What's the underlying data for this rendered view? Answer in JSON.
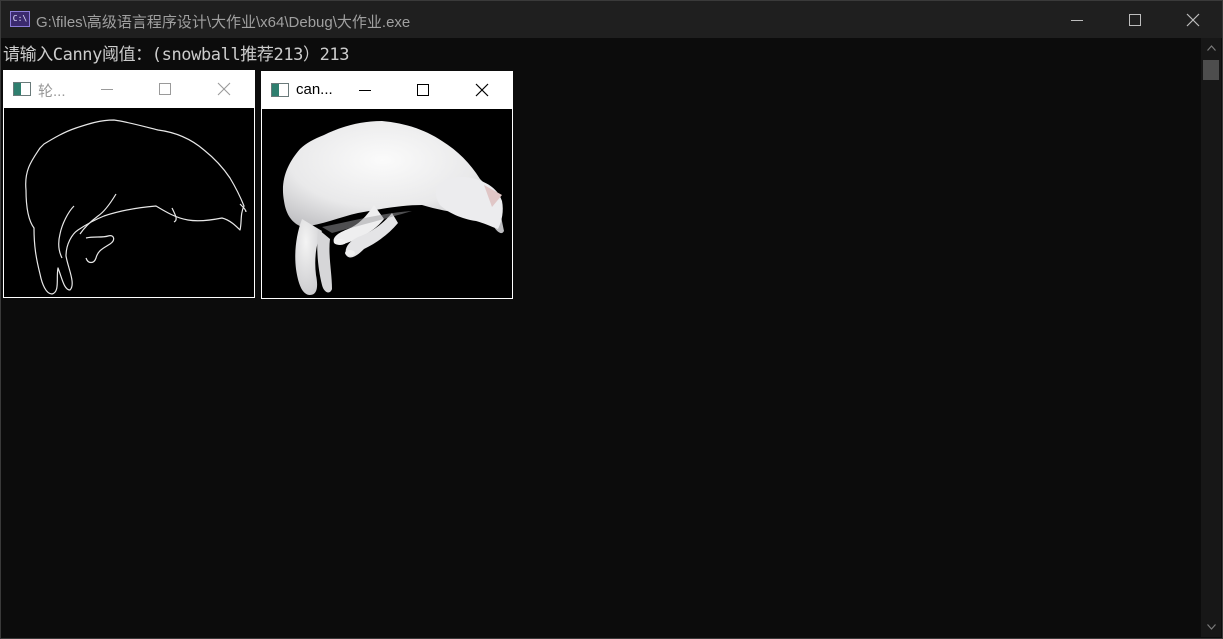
{
  "console": {
    "title": "G:\\files\\高级语言程序设计\\大作业\\x64\\Debug\\大作业.exe",
    "app_icon_text": "C:\\",
    "output_line": "请输入Canny阈值：(snowball推荐213）213"
  },
  "windows": [
    {
      "title": "轮...",
      "active": false
    },
    {
      "title": "can...",
      "active": true
    }
  ],
  "colors": {
    "console_bg": "#0c0c0c",
    "titlebar_bg": "#1f1f1f",
    "console_text": "#cccccc",
    "inactive_title_text": "#999999",
    "active_title_text": "#000000"
  }
}
